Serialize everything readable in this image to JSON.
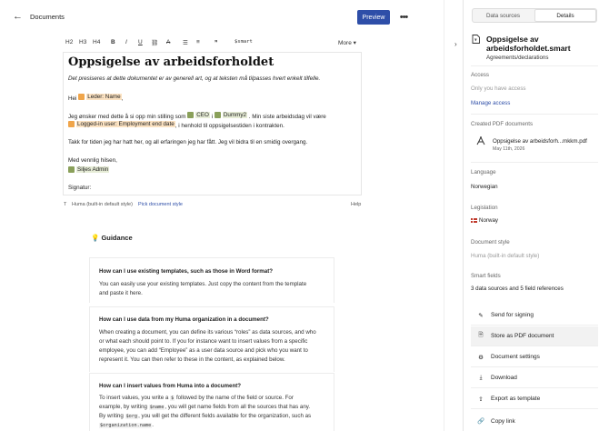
{
  "header": {
    "back_label": "←",
    "title": "Documents",
    "preview_label": "Preview",
    "more_label": "•••"
  },
  "toolbar": {
    "h2": "H2",
    "h3": "H3",
    "h4": "H4",
    "bold": "B",
    "italic": "I",
    "underline": "U",
    "link": "⛓",
    "strike": "A",
    "bullets": "☰",
    "numbers": "≡",
    "quote": "❞",
    "smart": "$smart",
    "more_label": "More ▾"
  },
  "editor": {
    "title": "Oppsigelse av arbeidsforholdet",
    "intro": "Det presiseres at dette dokumentet er av generell art, og at teksten må tilpasses hvert enkelt tilfelle.",
    "greeting_prefix": "Hei",
    "leader_field": "Leder: Name",
    "greeting_suffix": ",",
    "p1_prefix": "Jeg ønsker med dette å si opp min stilling som",
    "ceo_field": "CEO",
    "p1_mid": "i",
    "company_field": "Dummy2",
    "p1_suffix": ". Min siste arbeidsdag vil være",
    "end_date_field": "Logged-in user: Employment end date",
    "p1_end": ", i henhold til oppsigelsestiden i kontrakten.",
    "p2": "Takk for tiden jeg har hatt her, og all erfaringen jeg har fått. Jeg vil bidra til en smidig overgang.",
    "closing": "Med vennlig hilsen,",
    "signer_field": "Siljes Admin",
    "signature": "Signatur:"
  },
  "editor_footer": {
    "style_text": "Huma (built-in default style)",
    "pick_style": "Pick document style",
    "help": "Help"
  },
  "guidance": {
    "title": "Guidance",
    "items": [
      {
        "q": "How can I use existing templates, such as those in Word format?",
        "a1": "You can easily use your existing templates. Just copy the content from the template",
        "a2": "and paste it here."
      },
      {
        "q": "How can I use data from my Huma organization in a document?",
        "a1": "When creating a document, you can define its various “roles” as data sources, and who",
        "a2": "or what each should point to. If you for instance want to insert values from a specific",
        "a3": "employee, you can add “Employee” as a user data source and pick who you want to",
        "a4": "represent it. You can then refer to these in the content, as explained below."
      },
      {
        "q": "How can I insert values from Huma into a document?",
        "a1_pre": "To insert values, you write a",
        "a1_code": "$",
        "a1_post": "followed by the name of the field or source. For",
        "a2_pre": "example, by writing",
        "a2_code": "$name",
        "a2_post": ", you will get name fields from all the sources that has any.",
        "a3_pre": "By writing",
        "a3_code": "$org",
        "a3_post": ", you will get the different fields available for the organization, such as",
        "a4_code": "$organization.name",
        "a4_post": "."
      }
    ]
  },
  "panel": {
    "tab_sources": "Data sources",
    "tab_details": "Details",
    "doc_title": "Oppsigelse av arbeidsforholdet.smart",
    "doc_path": "Agreements/declarations",
    "access_label": "Access",
    "access_value": "Only you have access",
    "manage_access": "Manage access",
    "created_pdfs_label": "Created PDF documents",
    "pdf_name": "Oppsigelse av arbeidsforh...mkkm.pdf",
    "pdf_date": "May 11th, 2026",
    "language_label": "Language",
    "language_value": "Norwegian",
    "legislation_label": "Legislation",
    "legislation_value": "Norway",
    "doc_style_label": "Document style",
    "doc_style_value": "Huma (built-in default style)",
    "smart_fields_label": "Smart fields",
    "smart_fields_value": "3 data sources and 5 field references",
    "actions": [
      {
        "label": "Send for signing",
        "icon": "signature-icon"
      },
      {
        "label": "Store as PDF document",
        "icon": "pdf-icon"
      },
      {
        "label": "Document settings",
        "icon": "settings-icon"
      },
      {
        "label": "Download",
        "icon": "download-icon"
      },
      {
        "label": "Export as template",
        "icon": "export-icon"
      },
      {
        "label": "Copy link",
        "icon": "link-icon"
      }
    ]
  }
}
